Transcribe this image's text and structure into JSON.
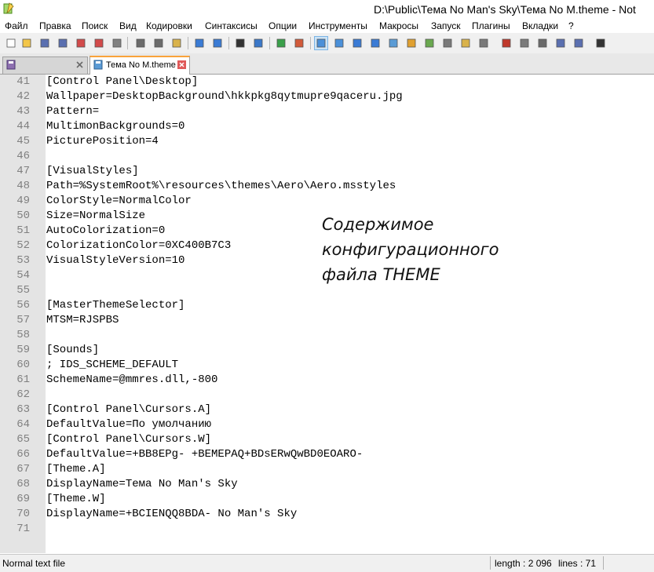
{
  "window": {
    "title": "D:\\Public\\Тема No Man's Sky\\Тема No M.theme - Not"
  },
  "menu": [
    "Файл",
    "Правка",
    "Поиск",
    "Вид",
    "Кодировки",
    "Синтаксисы",
    "Опции",
    "Инструменты",
    "Макросы",
    "Запуск",
    "Плагины",
    "Вкладки",
    "?"
  ],
  "toolbar": {
    "icons": [
      "new-file-icon",
      "open-file-icon",
      "save-icon",
      "save-all-icon",
      "close-icon",
      "close-all-icon",
      "print-icon",
      "cut-icon",
      "copy-icon",
      "paste-icon",
      "undo-icon",
      "redo-icon",
      "find-icon",
      "replace-icon",
      "zoom-in-icon",
      "zoom-out-icon",
      "sync-vertical-icon",
      "sync-horizontal-icon",
      "word-wrap-icon",
      "show-all-chars-icon",
      "indent-guide-icon",
      "user-language-icon",
      "doc-map-icon",
      "function-list-icon",
      "folder-workspace-icon",
      "monitoring-icon",
      "record-macro-icon",
      "stop-record-icon",
      "play-macro-icon",
      "run-macro-multiple-icon",
      "save-macro-icon",
      "spell-check-icon"
    ]
  },
  "tabs": [
    {
      "label": "",
      "active": false
    },
    {
      "label": "Тема No M.theme",
      "active": true
    }
  ],
  "editor": {
    "lines": [
      {
        "num": "41",
        "text": "[Control Panel\\Desktop]"
      },
      {
        "num": "42",
        "text": "Wallpaper=DesktopBackground\\hkkpkg8qytmupre9qaceru.jpg"
      },
      {
        "num": "43",
        "text": "Pattern="
      },
      {
        "num": "44",
        "text": "MultimonBackgrounds=0"
      },
      {
        "num": "45",
        "text": "PicturePosition=4"
      },
      {
        "num": "46",
        "text": ""
      },
      {
        "num": "47",
        "text": "[VisualStyles]"
      },
      {
        "num": "48",
        "text": "Path=%SystemRoot%\\resources\\themes\\Aero\\Aero.msstyles"
      },
      {
        "num": "49",
        "text": "ColorStyle=NormalColor"
      },
      {
        "num": "50",
        "text": "Size=NormalSize"
      },
      {
        "num": "51",
        "text": "AutoColorization=0"
      },
      {
        "num": "52",
        "text": "ColorizationColor=0XC400B7C3"
      },
      {
        "num": "53",
        "text": "VisualStyleVersion=10"
      },
      {
        "num": "54",
        "text": ""
      },
      {
        "num": "55",
        "text": ""
      },
      {
        "num": "56",
        "text": "[MasterThemeSelector]"
      },
      {
        "num": "57",
        "text": "MTSM=RJSPBS"
      },
      {
        "num": "58",
        "text": ""
      },
      {
        "num": "59",
        "text": "[Sounds]"
      },
      {
        "num": "60",
        "text": "; IDS_SCHEME_DEFAULT"
      },
      {
        "num": "61",
        "text": "SchemeName=@mmres.dll,-800"
      },
      {
        "num": "62",
        "text": ""
      },
      {
        "num": "63",
        "text": "[Control Panel\\Cursors.A]"
      },
      {
        "num": "64",
        "text": "DefaultValue=По умолчанию"
      },
      {
        "num": "65",
        "text": "[Control Panel\\Cursors.W]"
      },
      {
        "num": "66",
        "text": "DefaultValue=+BB8EPg- +BEMEPAQ+BDsERwQwBD0EOARO-"
      },
      {
        "num": "67",
        "text": "[Theme.A]"
      },
      {
        "num": "68",
        "text": "DisplayName=Тема No Man's Sky"
      },
      {
        "num": "69",
        "text": "[Theme.W]"
      },
      {
        "num": "70",
        "text": "DisplayName=+BCIENQQ8BDA- No Man's Sky"
      },
      {
        "num": "71",
        "text": ""
      }
    ]
  },
  "annotation": {
    "lines": [
      "Содержимое",
      "конфигурационного",
      "файла THEME"
    ]
  },
  "status": {
    "type": "Normal text file",
    "length": "length : 2 096",
    "lines": "lines : 71"
  }
}
